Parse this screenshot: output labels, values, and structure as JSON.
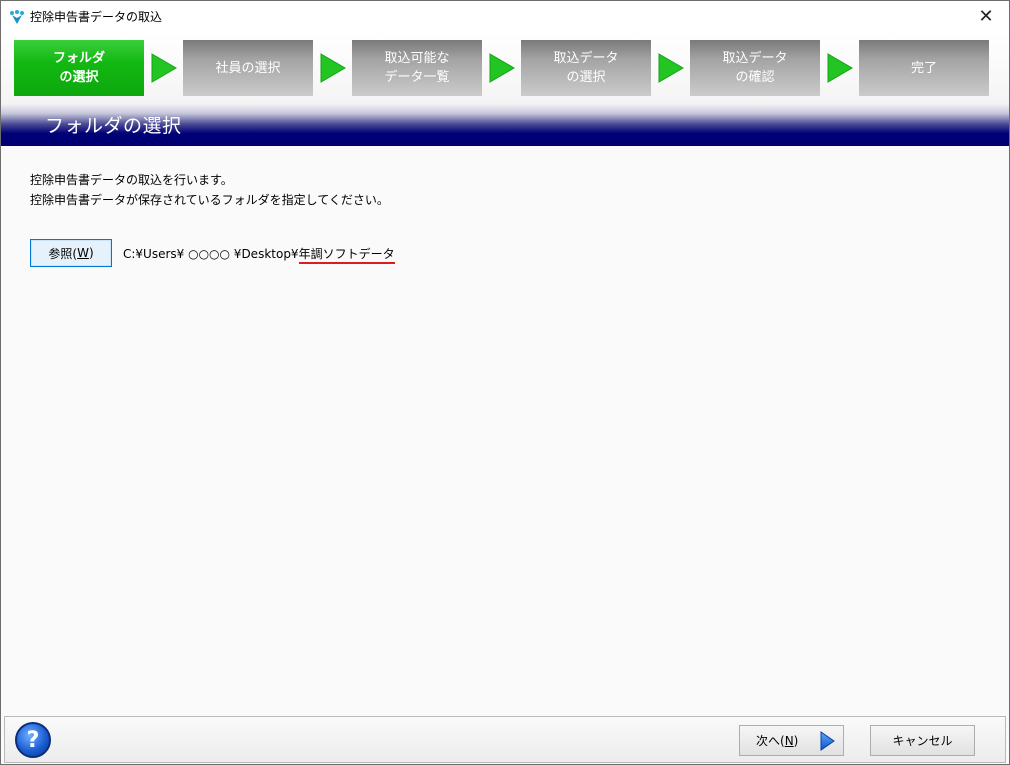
{
  "window": {
    "title": "控除申告書データの取込",
    "close_glyph": "✕"
  },
  "steps": [
    {
      "lines": [
        "フォルダ",
        "の選択"
      ],
      "active": true
    },
    {
      "lines": [
        "社員の選択"
      ],
      "active": false
    },
    {
      "lines": [
        "取込可能な",
        "データ一覧"
      ],
      "active": false
    },
    {
      "lines": [
        "取込データ",
        "の選択"
      ],
      "active": false
    },
    {
      "lines": [
        "取込データ",
        "の確認"
      ],
      "active": false
    },
    {
      "lines": [
        "完了"
      ],
      "active": false
    }
  ],
  "banner": {
    "title": "フォルダの選択"
  },
  "content": {
    "description_line1": "控除申告書データの取込を行います。",
    "description_line2": "控除申告書データが保存されているフォルダを指定してください。",
    "browse_label": "参照(",
    "browse_key": "W",
    "browse_close": ")",
    "path_prefix": "C:¥Users¥ ○○○○ ¥Desktop¥",
    "path_folder": "年調ソフトデータ"
  },
  "footer": {
    "help_label": "?",
    "next_label": "次へ(",
    "next_key": "N",
    "next_close": ")",
    "cancel_label": "キャンセル"
  },
  "colors": {
    "active_step": "#12b812",
    "inactive_step": "#a4a4a4",
    "arrow_green": "#22c522",
    "banner_navy": "#000078"
  },
  "icons": {
    "app": "crown-icon",
    "step_arrow": "triangle-right-icon",
    "next": "blue-triangle-right-icon",
    "help": "question-circle-icon"
  }
}
